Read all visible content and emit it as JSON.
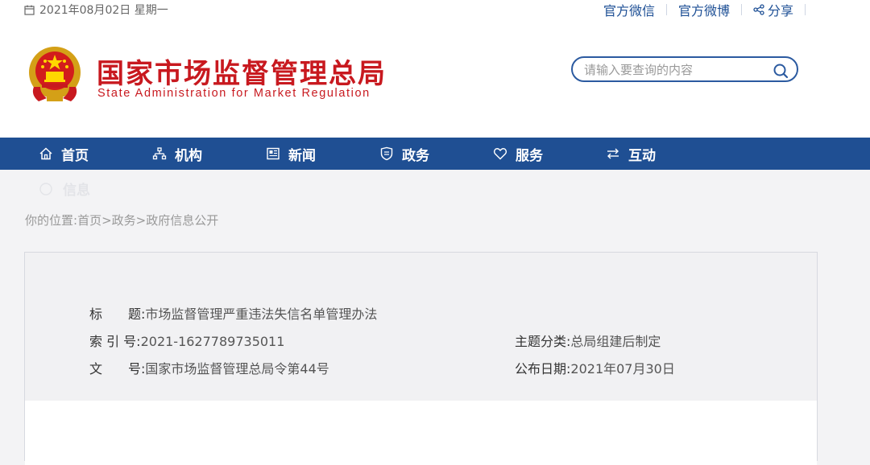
{
  "topbar": {
    "date": "2021年08月02日  星期一",
    "links": [
      "官方微信",
      "官方微博"
    ],
    "share": "分享"
  },
  "brand": {
    "name_cn": "国家市场监督管理总局",
    "name_en": "State Administration for Market Regulation"
  },
  "search": {
    "placeholder": "请输入要查询的内容"
  },
  "nav": {
    "items": [
      {
        "label": "首页",
        "icon": "home-icon"
      },
      {
        "label": "机构",
        "icon": "org-chart-icon"
      },
      {
        "label": "新闻",
        "icon": "news-icon"
      },
      {
        "label": "政务",
        "icon": "shield-icon"
      },
      {
        "label": "服务",
        "icon": "heart-icon"
      },
      {
        "label": "互动",
        "icon": "arrows-exchange-icon"
      }
    ],
    "overflow_label": "信息"
  },
  "breadcrumb": {
    "prefix": "你的位置:",
    "items": [
      "首页",
      "政务",
      "政府信息公开"
    ],
    "separator": ">"
  },
  "meta": {
    "title_label": "标　　题:",
    "title_value": "市场监督管理严重违法失信名单管理办法",
    "index_label": "索 引 号:",
    "index_value": "2021-1627789735011",
    "doc_label": "文　　号:",
    "doc_value": "国家市场监督管理总局令第44号",
    "topic_label": "主题分类:",
    "topic_value": "总局组建后制定",
    "date_label": "公布日期:",
    "date_value": "2021年07月30日"
  },
  "colors": {
    "brand_red": "#c8191f",
    "nav_blue": "#1f4f93",
    "link_blue": "#1d4f95"
  }
}
